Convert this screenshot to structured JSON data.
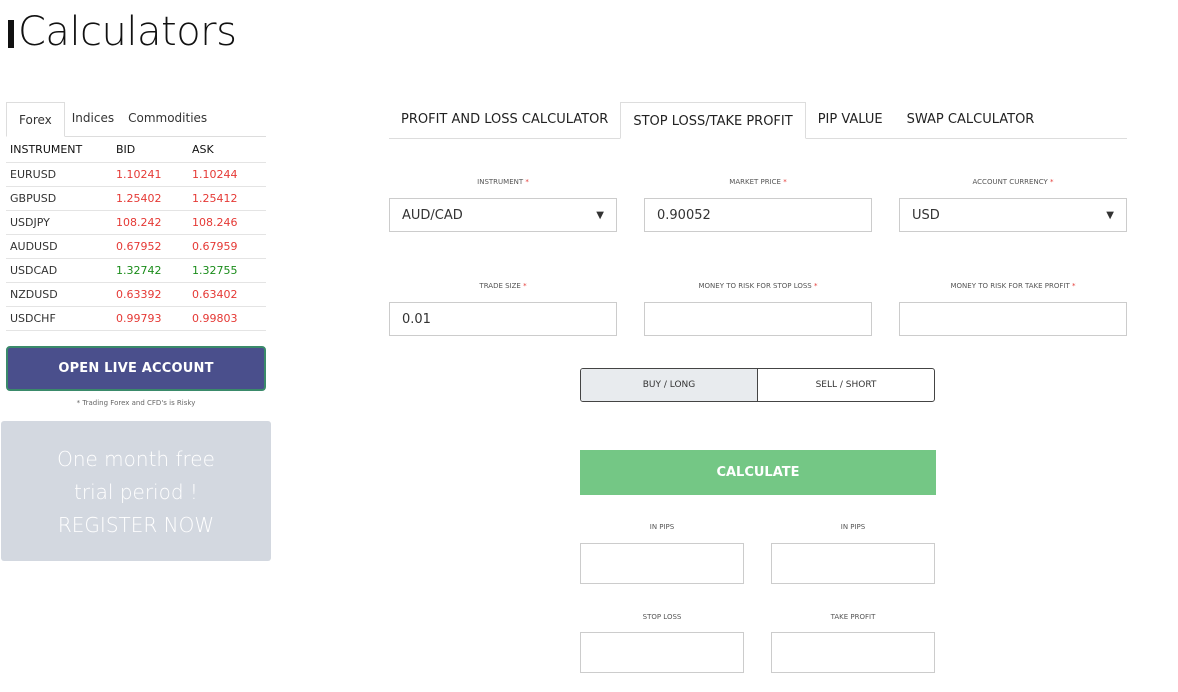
{
  "page": {
    "title": "Calculators"
  },
  "sidebar": {
    "tabs": [
      "Forex",
      "Indices",
      "Commodities"
    ],
    "active_tab": "Forex",
    "table": {
      "headers": [
        "INSTRUMENT",
        "BID",
        "ASK"
      ],
      "rows": [
        {
          "instrument": "EURUSD",
          "bid": "1.10241",
          "ask": "1.10244",
          "trend": "down"
        },
        {
          "instrument": "GBPUSD",
          "bid": "1.25402",
          "ask": "1.25412",
          "trend": "down"
        },
        {
          "instrument": "USDJPY",
          "bid": "108.242",
          "ask": "108.246",
          "trend": "down"
        },
        {
          "instrument": "AUDUSD",
          "bid": "0.67952",
          "ask": "0.67959",
          "trend": "down"
        },
        {
          "instrument": "USDCAD",
          "bid": "1.32742",
          "ask": "1.32755",
          "trend": "up"
        },
        {
          "instrument": "NZDUSD",
          "bid": "0.63392",
          "ask": "0.63402",
          "trend": "down"
        },
        {
          "instrument": "USDCHF",
          "bid": "0.99793",
          "ask": "0.99803",
          "trend": "down"
        }
      ]
    },
    "open_account_label": "OPEN LIVE ACCOUNT",
    "risk_note": "* Trading Forex and CFD's is Risky",
    "promo": {
      "line1": "One month free",
      "line2": "trial period !",
      "line3": "REGISTER NOW"
    }
  },
  "calculator": {
    "tabs": [
      "PROFIT AND LOSS CALCULATOR",
      "STOP LOSS/TAKE PROFIT",
      "PIP VALUE",
      "SWAP CALCULATOR"
    ],
    "active_tab": "STOP LOSS/TAKE PROFIT",
    "fields": {
      "instrument": {
        "label": "INSTRUMENT",
        "value": "AUD/CAD"
      },
      "market_price": {
        "label": "MARKET PRICE",
        "value": "0.90052"
      },
      "account_currency": {
        "label": "ACCOUNT CURRENCY",
        "value": "USD"
      },
      "trade_size": {
        "label": "TRADE SIZE",
        "value": "0.01"
      },
      "money_stop_loss": {
        "label": "MONEY TO RISK FOR STOP LOSS",
        "value": ""
      },
      "money_take_profit": {
        "label": "MONEY TO RISK FOR TAKE PROFIT",
        "value": ""
      }
    },
    "required_mark": "*",
    "direction": {
      "buy_label": "BUY / LONG",
      "sell_label": "SELL / SHORT",
      "selected": "buy"
    },
    "calculate_label": "CALCULATE",
    "results": {
      "in_pips_left_label": "IN PIPS",
      "in_pips_right_label": "IN PIPS",
      "stop_loss_label": "STOP LOSS",
      "take_profit_label": "TAKE PROFIT"
    }
  },
  "colors": {
    "ask_down": "#e53935",
    "ask_up": "#1a8c1a",
    "primary_button": "#4a4f8c",
    "calculate_button": "#74c785",
    "promo_bg": "#d3d8e0"
  }
}
